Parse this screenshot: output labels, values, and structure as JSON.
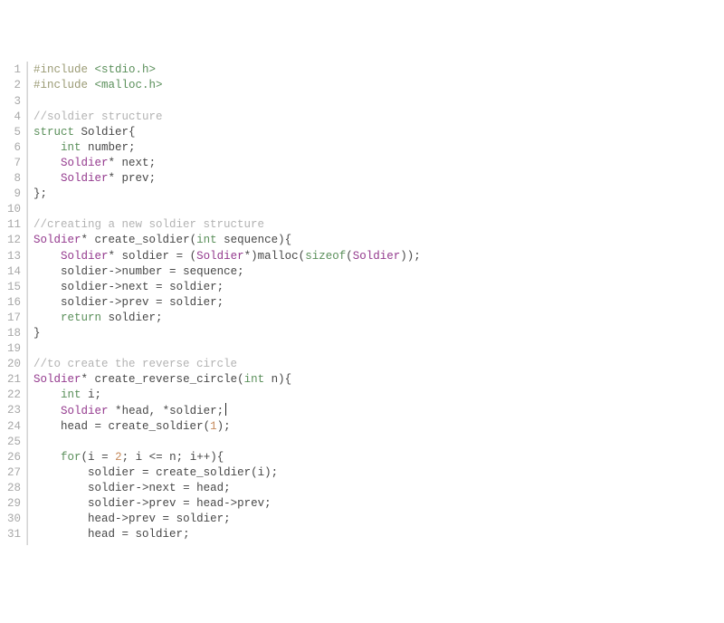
{
  "gutter": [
    "1",
    "2",
    "3",
    "4",
    "5",
    "6",
    "7",
    "8",
    "9",
    "10",
    "11",
    "12",
    "13",
    "14",
    "15",
    "16",
    "17",
    "18",
    "19",
    "20",
    "21",
    "22",
    "23",
    "24",
    "25",
    "26",
    "27",
    "28",
    "29",
    "30",
    "31"
  ],
  "lines": [
    [
      [
        "pp",
        "#include "
      ],
      [
        "hdr",
        "<stdio.h>"
      ]
    ],
    [
      [
        "pp",
        "#include "
      ],
      [
        "hdr",
        "<malloc.h>"
      ]
    ],
    [],
    [
      [
        "cmt",
        "//soldier structure"
      ]
    ],
    [
      [
        "kw",
        "struct"
      ],
      [
        "id",
        " Soldier"
      ],
      [
        "pun",
        "{"
      ]
    ],
    [
      [
        "id",
        "    "
      ],
      [
        "kw",
        "int"
      ],
      [
        "id",
        " number"
      ],
      [
        "pun",
        ";"
      ]
    ],
    [
      [
        "id",
        "    "
      ],
      [
        "type",
        "Soldier"
      ],
      [
        "op",
        "*"
      ],
      [
        "id",
        " next"
      ],
      [
        "pun",
        ";"
      ]
    ],
    [
      [
        "id",
        "    "
      ],
      [
        "type",
        "Soldier"
      ],
      [
        "op",
        "*"
      ],
      [
        "id",
        " prev"
      ],
      [
        "pun",
        ";"
      ]
    ],
    [
      [
        "pun",
        "};"
      ]
    ],
    [],
    [
      [
        "cmt",
        "//creating a new soldier structure"
      ]
    ],
    [
      [
        "type",
        "Soldier"
      ],
      [
        "op",
        "*"
      ],
      [
        "id",
        " "
      ],
      [
        "fn",
        "create_soldier"
      ],
      [
        "pun",
        "("
      ],
      [
        "kw",
        "int"
      ],
      [
        "id",
        " sequence"
      ],
      [
        "pun",
        "){"
      ]
    ],
    [
      [
        "id",
        "    "
      ],
      [
        "type",
        "Soldier"
      ],
      [
        "op",
        "*"
      ],
      [
        "id",
        " soldier "
      ],
      [
        "op",
        "="
      ],
      [
        "id",
        " "
      ],
      [
        "pun",
        "("
      ],
      [
        "type",
        "Soldier"
      ],
      [
        "op",
        "*"
      ],
      [
        "pun",
        ")"
      ],
      [
        "fn",
        "malloc"
      ],
      [
        "pun",
        "("
      ],
      [
        "kw",
        "sizeof"
      ],
      [
        "pun",
        "("
      ],
      [
        "type",
        "Soldier"
      ],
      [
        "pun",
        "));"
      ]
    ],
    [
      [
        "id",
        "    soldier"
      ],
      [
        "op",
        "->"
      ],
      [
        "id",
        "number "
      ],
      [
        "op",
        "="
      ],
      [
        "id",
        " sequence"
      ],
      [
        "pun",
        ";"
      ]
    ],
    [
      [
        "id",
        "    soldier"
      ],
      [
        "op",
        "->"
      ],
      [
        "id",
        "next "
      ],
      [
        "op",
        "="
      ],
      [
        "id",
        " soldier"
      ],
      [
        "pun",
        ";"
      ]
    ],
    [
      [
        "id",
        "    soldier"
      ],
      [
        "op",
        "->"
      ],
      [
        "id",
        "prev "
      ],
      [
        "op",
        "="
      ],
      [
        "id",
        " soldier"
      ],
      [
        "pun",
        ";"
      ]
    ],
    [
      [
        "id",
        "    "
      ],
      [
        "kw",
        "return"
      ],
      [
        "id",
        " soldier"
      ],
      [
        "pun",
        ";"
      ]
    ],
    [
      [
        "pun",
        "}"
      ]
    ],
    [],
    [
      [
        "cmt",
        "//to create the reverse circle"
      ]
    ],
    [
      [
        "type",
        "Soldier"
      ],
      [
        "op",
        "*"
      ],
      [
        "id",
        " "
      ],
      [
        "fn",
        "create_reverse_circle"
      ],
      [
        "pun",
        "("
      ],
      [
        "kw",
        "int"
      ],
      [
        "id",
        " n"
      ],
      [
        "pun",
        "){"
      ]
    ],
    [
      [
        "id",
        "    "
      ],
      [
        "kw",
        "int"
      ],
      [
        "id",
        " i"
      ],
      [
        "pun",
        ";"
      ]
    ],
    [
      [
        "id",
        "    "
      ],
      [
        "type",
        "Soldier"
      ],
      [
        "id",
        " "
      ],
      [
        "op",
        "*"
      ],
      [
        "id",
        "head"
      ],
      [
        "pun",
        ","
      ],
      [
        "id",
        " "
      ],
      [
        "op",
        "*"
      ],
      [
        "id",
        "soldier"
      ],
      [
        "pun",
        ";"
      ],
      [
        "cursor",
        ""
      ]
    ],
    [
      [
        "id",
        "    head "
      ],
      [
        "op",
        "="
      ],
      [
        "id",
        " "
      ],
      [
        "fn",
        "create_soldier"
      ],
      [
        "pun",
        "("
      ],
      [
        "num",
        "1"
      ],
      [
        "pun",
        ");"
      ]
    ],
    [],
    [
      [
        "id",
        "    "
      ],
      [
        "kw",
        "for"
      ],
      [
        "pun",
        "("
      ],
      [
        "id",
        "i "
      ],
      [
        "op",
        "="
      ],
      [
        "id",
        " "
      ],
      [
        "num",
        "2"
      ],
      [
        "pun",
        ";"
      ],
      [
        "id",
        " i "
      ],
      [
        "op",
        "<="
      ],
      [
        "id",
        " n"
      ],
      [
        "pun",
        ";"
      ],
      [
        "id",
        " i"
      ],
      [
        "op",
        "++"
      ],
      [
        "pun",
        "){"
      ]
    ],
    [
      [
        "id",
        "        soldier "
      ],
      [
        "op",
        "="
      ],
      [
        "id",
        " "
      ],
      [
        "fn",
        "create_soldier"
      ],
      [
        "pun",
        "("
      ],
      [
        "id",
        "i"
      ],
      [
        "pun",
        ");"
      ]
    ],
    [
      [
        "id",
        "        soldier"
      ],
      [
        "op",
        "->"
      ],
      [
        "id",
        "next "
      ],
      [
        "op",
        "="
      ],
      [
        "id",
        " head"
      ],
      [
        "pun",
        ";"
      ]
    ],
    [
      [
        "id",
        "        soldier"
      ],
      [
        "op",
        "->"
      ],
      [
        "id",
        "prev "
      ],
      [
        "op",
        "="
      ],
      [
        "id",
        " head"
      ],
      [
        "op",
        "->"
      ],
      [
        "id",
        "prev"
      ],
      [
        "pun",
        ";"
      ]
    ],
    [
      [
        "id",
        "        head"
      ],
      [
        "op",
        "->"
      ],
      [
        "id",
        "prev "
      ],
      [
        "op",
        "="
      ],
      [
        "id",
        " soldier"
      ],
      [
        "pun",
        ";"
      ]
    ],
    [
      [
        "id",
        "        head "
      ],
      [
        "op",
        "="
      ],
      [
        "id",
        " soldier"
      ],
      [
        "pun",
        ";"
      ]
    ]
  ]
}
